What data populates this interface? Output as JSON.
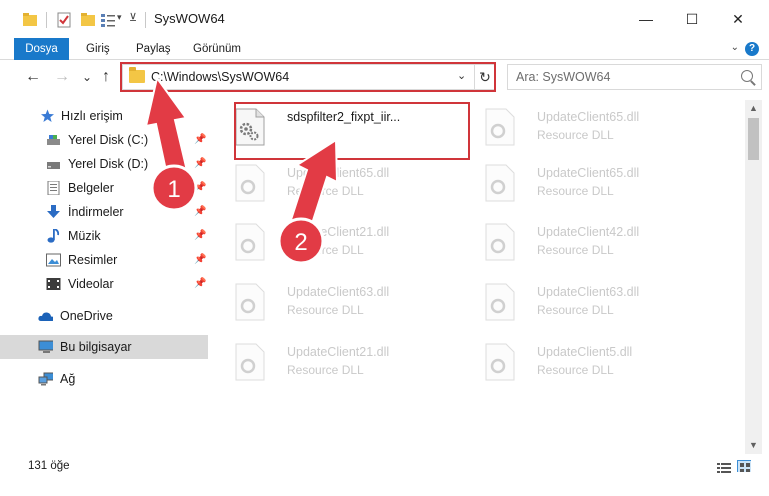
{
  "window": {
    "title": "SysWOW64",
    "controls": {
      "minimize": "—",
      "maximize": "☐",
      "close": "✕"
    }
  },
  "ribbon": {
    "tabs": [
      "Dosya",
      "Giriş",
      "Paylaş",
      "Görünüm"
    ],
    "help": "?"
  },
  "navigation": {
    "back": "←",
    "forward": "→",
    "recent": "⌄",
    "up": "↑",
    "address": "C:\\Windows\\SysWOW64",
    "search_placeholder": "Ara: SysWOW64"
  },
  "sidebar": {
    "items": [
      {
        "label": "Hızlı erişim",
        "icon": "star-icon",
        "pinned": false
      },
      {
        "label": "Yerel Disk (C:)",
        "icon": "drive-icon",
        "pinned": true
      },
      {
        "label": "Yerel Disk (D:)",
        "icon": "drive-icon",
        "pinned": true
      },
      {
        "label": "Belgeler",
        "icon": "documents-icon",
        "pinned": true
      },
      {
        "label": "İndirmeler",
        "icon": "download-icon",
        "pinned": true
      },
      {
        "label": "Müzik",
        "icon": "music-icon",
        "pinned": true
      },
      {
        "label": "Resimler",
        "icon": "pictures-icon",
        "pinned": true
      },
      {
        "label": "Videolar",
        "icon": "videos-icon",
        "pinned": true
      },
      {
        "label": "OneDrive",
        "icon": "cloud-icon",
        "pinned": false
      },
      {
        "label": "Bu bilgisayar",
        "icon": "computer-icon",
        "pinned": false,
        "selected": true
      },
      {
        "label": "Ağ",
        "icon": "network-icon",
        "pinned": false
      }
    ]
  },
  "files": [
    {
      "name": "sdspfilter2_fixpt_iir...",
      "type": "",
      "highlighted": true
    },
    {
      "name": "UpdateClient65.dll",
      "type": "Resource DLL"
    },
    {
      "name": "UpdateClient65.dll",
      "type": "Resource DLL"
    },
    {
      "name": "UpdateClient65.dll",
      "type": "Resource DLL"
    },
    {
      "name": "UpdateClient21.dll",
      "type": "Resource DLL"
    },
    {
      "name": "UpdateClient42.dll",
      "type": "Resource DLL"
    },
    {
      "name": "UpdateClient63.dll",
      "type": "Resource DLL"
    },
    {
      "name": "UpdateClient63.dll",
      "type": "Resource DLL"
    },
    {
      "name": "UpdateClient21.dll",
      "type": "Resource DLL"
    },
    {
      "name": "UpdateClient5.dll",
      "type": "Resource DLL"
    }
  ],
  "status": {
    "item_count": "131 öğe"
  },
  "annotations": {
    "step1": "1",
    "step2": "2",
    "highlight_color": "#d0353a"
  },
  "colors": {
    "accent": "#1979ca",
    "selection": "#d9d9d9"
  }
}
